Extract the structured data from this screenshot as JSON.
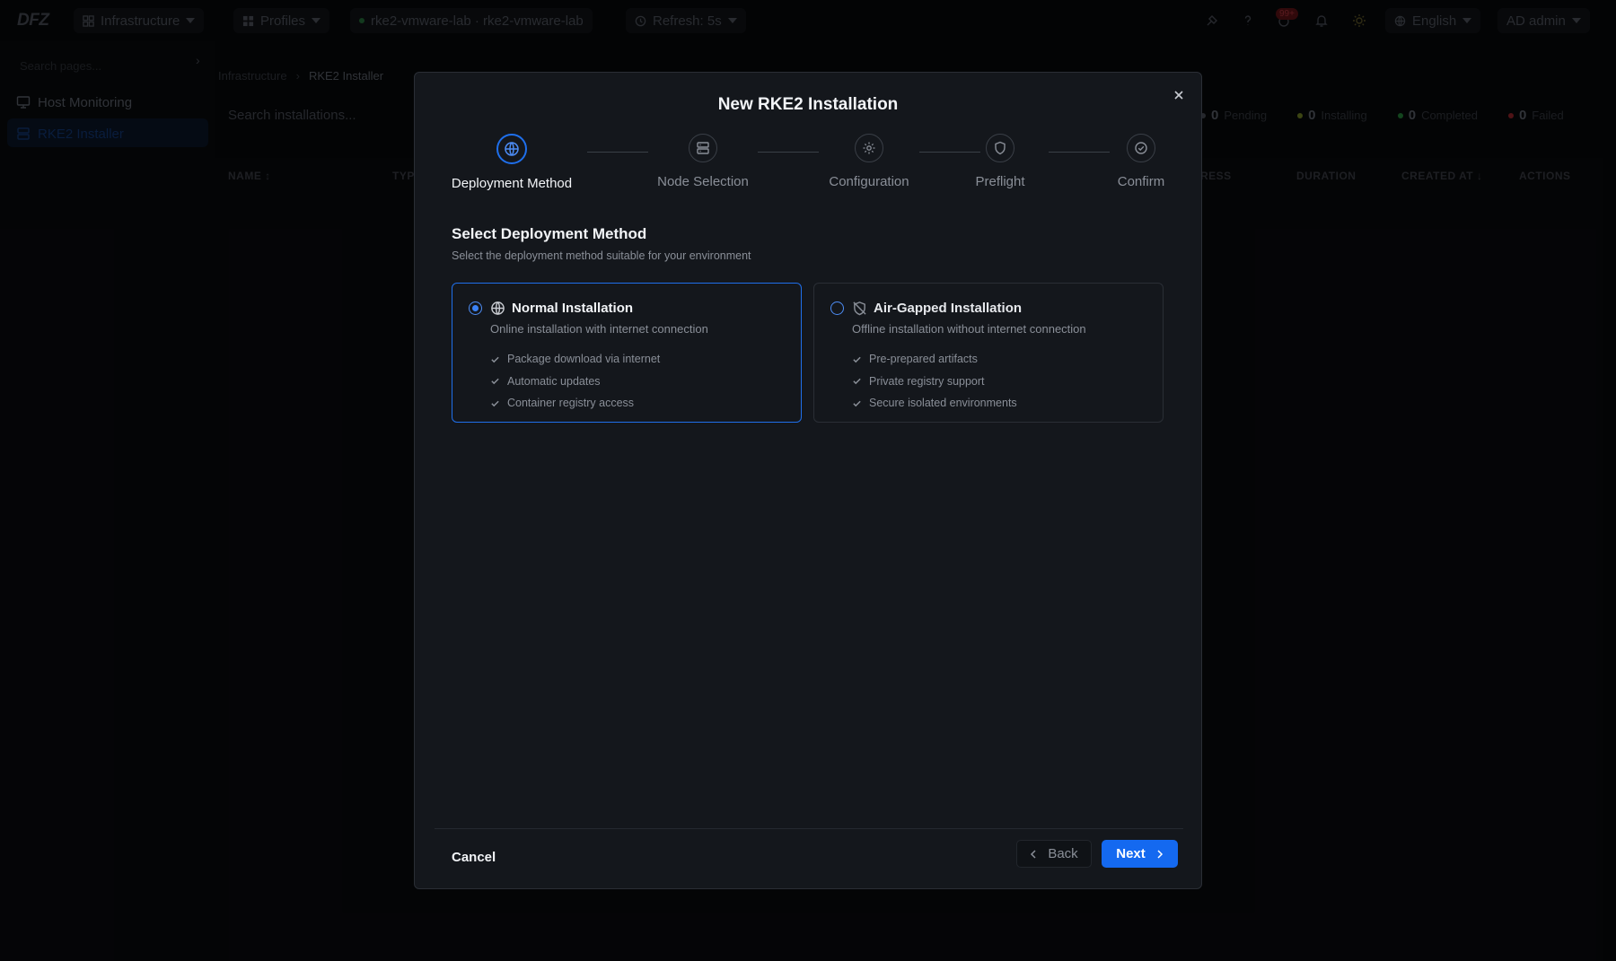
{
  "topbar": {
    "logo": "DFZ",
    "infrastructure_label": "Infrastructure",
    "profiles_label": "Profiles",
    "cluster_label": "rke2-vmware-lab · rke2-vmware-lab",
    "refresh_label": "Refresh: 5s",
    "notifications_badge": "99+",
    "language_label": "English",
    "user_label": "AD  admin"
  },
  "sidebar": {
    "search_placeholder": "Search pages...",
    "items": [
      {
        "label": "Host Monitoring"
      },
      {
        "label": "RKE2 Installer"
      }
    ]
  },
  "page": {
    "breadcrumb": [
      "Infrastructure",
      "RKE2 Installer"
    ],
    "search_placeholder": "Search installations...",
    "stats": [
      {
        "count": "0",
        "label": "Pending",
        "color": "#3a3d44"
      },
      {
        "count": "0",
        "label": "Installing",
        "color": "#5c6b1e"
      },
      {
        "count": "0",
        "label": "Completed",
        "color": "#1e6b2e"
      },
      {
        "count": "0",
        "label": "Failed",
        "color": "#7a1e22"
      }
    ],
    "columns": [
      "NAME ↕",
      "TYP",
      "RESS",
      "DURATION",
      "CREATED AT ↓",
      "ACTIONS"
    ]
  },
  "modal": {
    "title": "New RKE2 Installation",
    "steps": [
      {
        "label": "Deployment Method",
        "icon": "globe-icon"
      },
      {
        "label": "Node Selection",
        "icon": "server-icon"
      },
      {
        "label": "Configuration",
        "icon": "gear-icon"
      },
      {
        "label": "Preflight",
        "icon": "shield-icon"
      },
      {
        "label": "Confirm",
        "icon": "check-circle-icon"
      }
    ],
    "active_step": 0,
    "section_title": "Select Deployment Method",
    "section_subtitle": "Select the deployment method suitable for your environment",
    "options": [
      {
        "title": "Normal Installation",
        "description": "Online installation with internet connection",
        "features": [
          "Package download via internet",
          "Automatic updates",
          "Container registry access"
        ],
        "selected": true,
        "icon": "globe-icon"
      },
      {
        "title": "Air-Gapped Installation",
        "description": "Offline installation without internet connection",
        "features": [
          "Pre-prepared artifacts",
          "Private registry support",
          "Secure isolated environments"
        ],
        "selected": false,
        "icon": "no-network-icon"
      }
    ],
    "cancel_label": "Cancel",
    "back_label": "Back",
    "next_label": "Next",
    "accent_color": "#1469f0"
  }
}
